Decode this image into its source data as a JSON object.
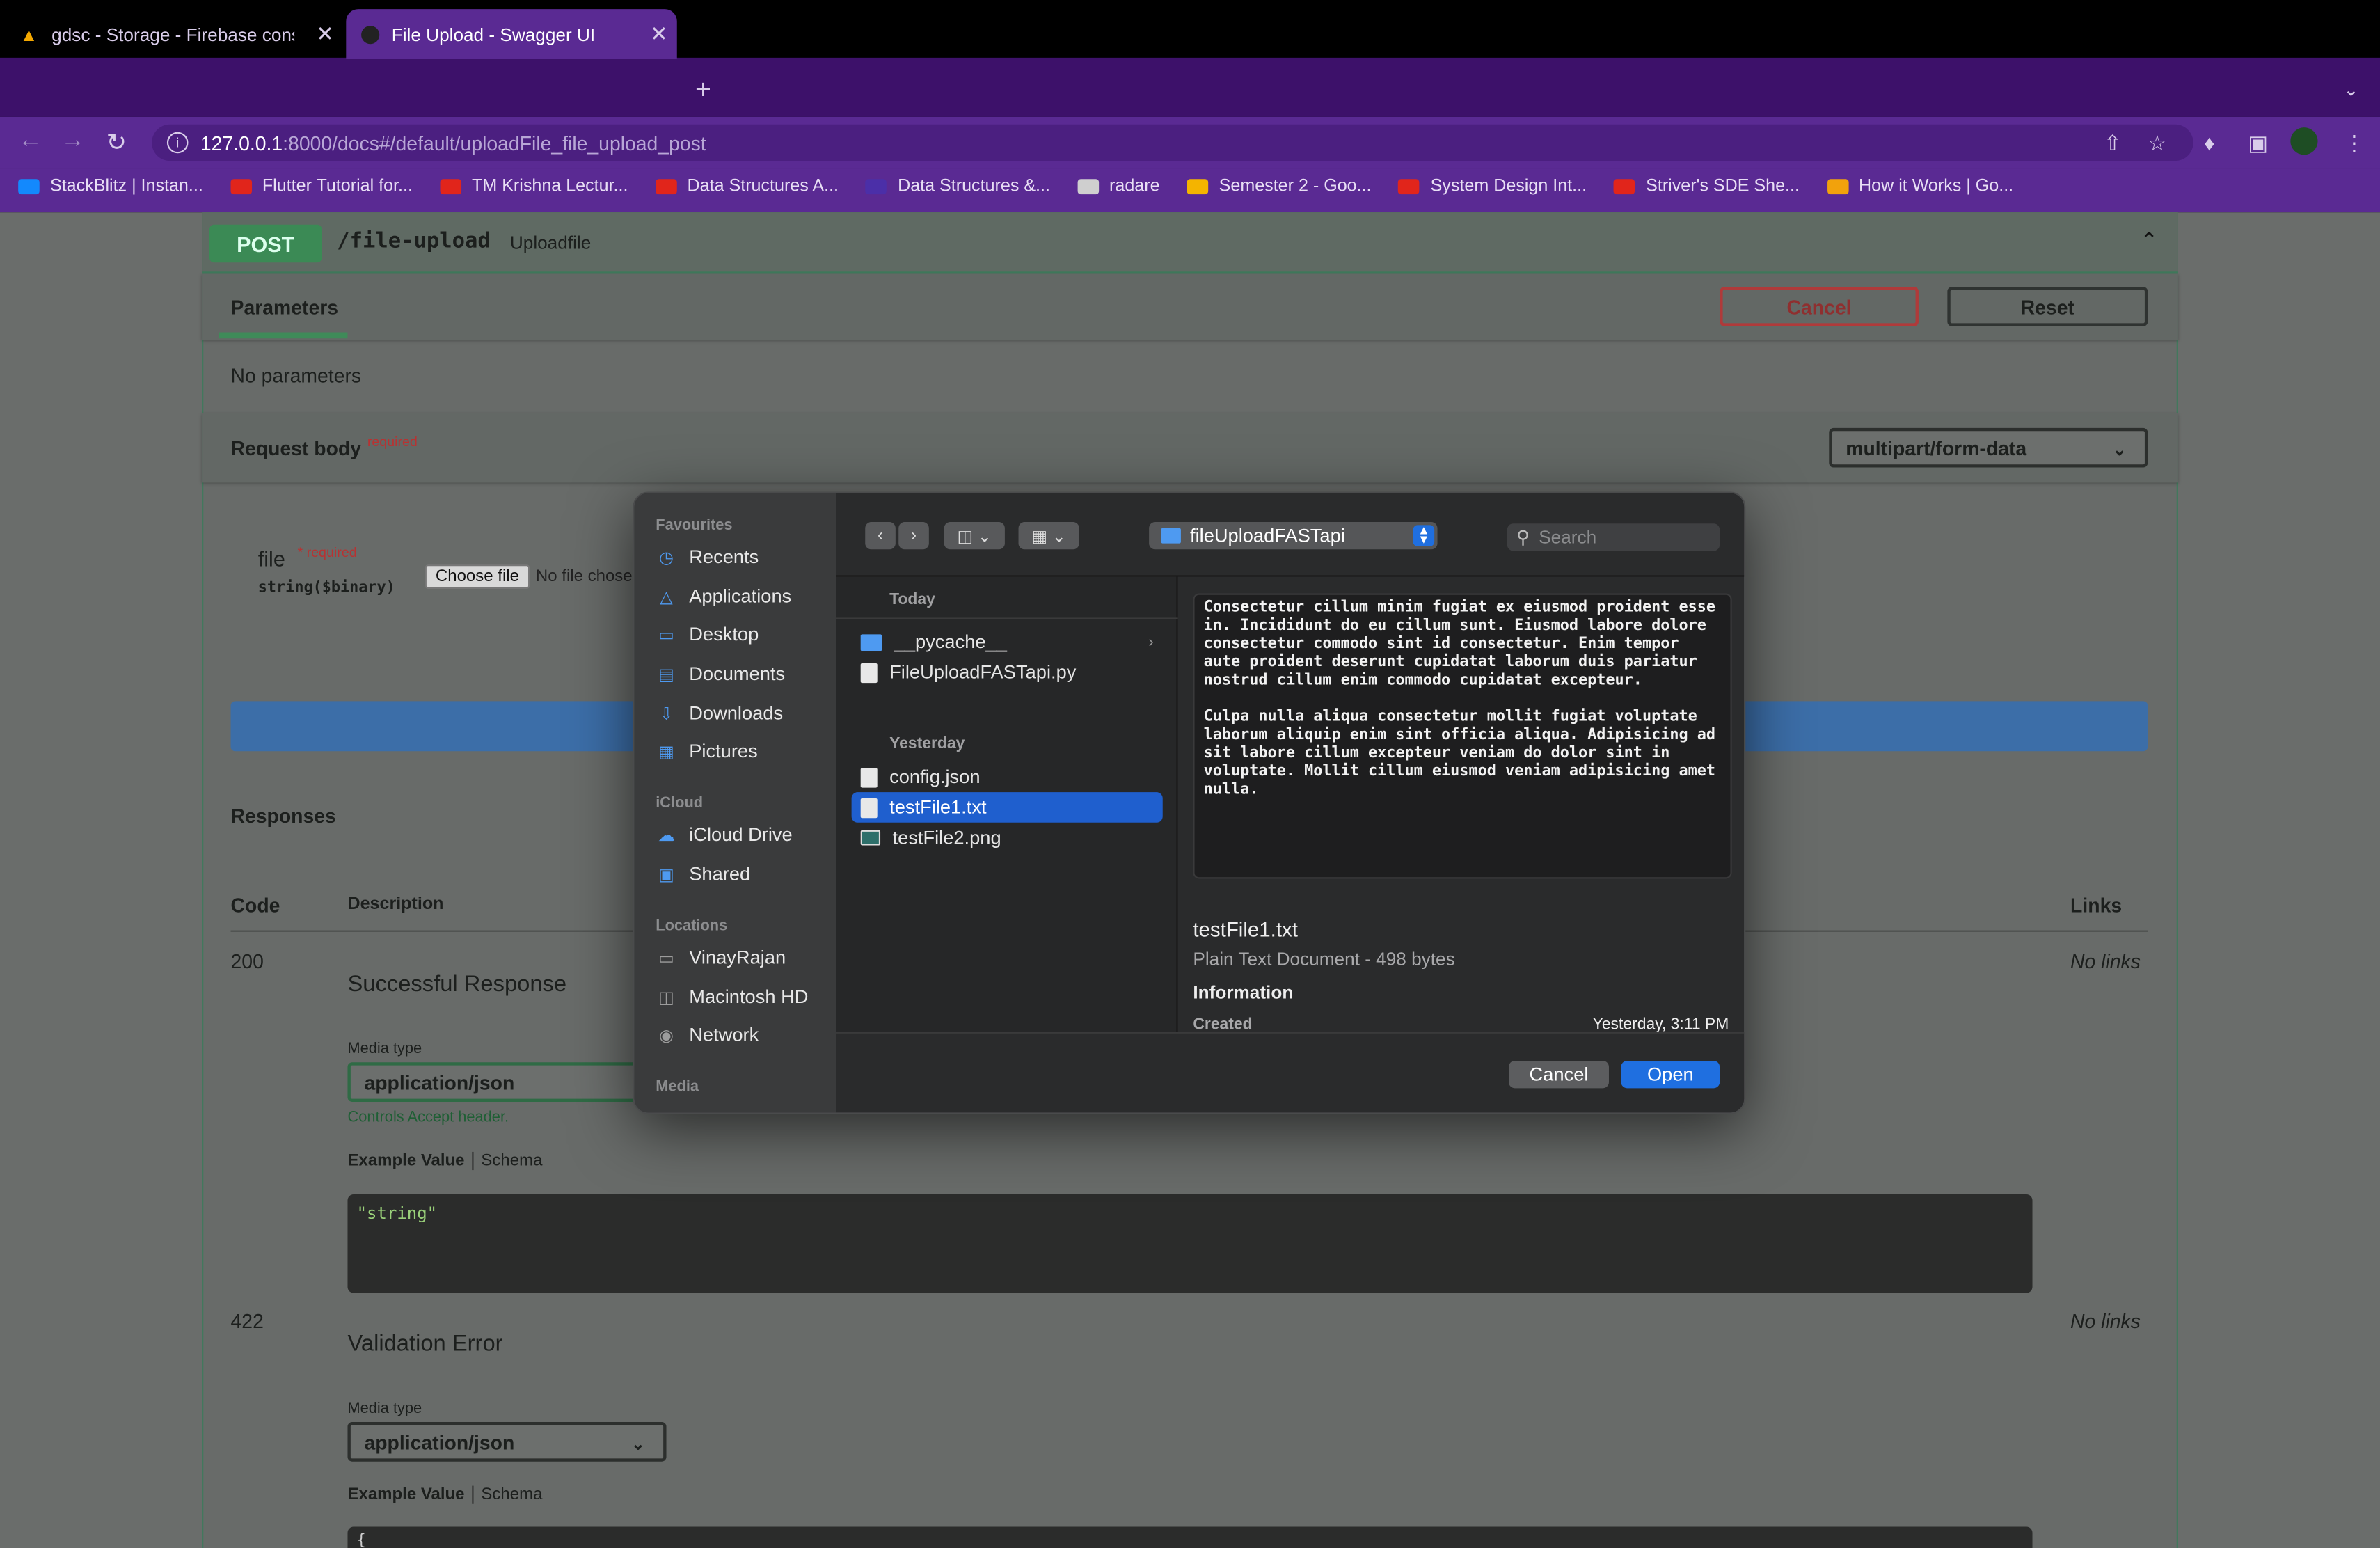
{
  "browser": {
    "tabs": [
      {
        "title": "gdsc - Storage - Firebase cons",
        "active": false
      },
      {
        "title": "File Upload - Swagger UI",
        "active": true
      }
    ],
    "url_host": "127.0.0.1",
    "url_rest": ":8000/docs#/default/uploadFile_file_upload_post",
    "bookmarks": [
      {
        "label": "StackBlitz | Instan...",
        "color": "#1389fd"
      },
      {
        "label": "Flutter Tutorial for...",
        "color": "#e1251b"
      },
      {
        "label": "TM Krishna Lectur...",
        "color": "#e1251b"
      },
      {
        "label": "Data Structures A...",
        "color": "#e1251b"
      },
      {
        "label": "Data Structures &...",
        "color": "#4b2fa8"
      },
      {
        "label": "radare",
        "color": "#cfcfcf"
      },
      {
        "label": "Semester 2 - Goo...",
        "color": "#f4b400"
      },
      {
        "label": "System Design Int...",
        "color": "#e1251b"
      },
      {
        "label": "Striver's SDE She...",
        "color": "#e1251b"
      },
      {
        "label": "How it Works | Go...",
        "color": "#f2a20c"
      }
    ]
  },
  "swagger": {
    "method": "POST",
    "path": "/file-upload",
    "summary": "Uploadfile",
    "parameters_tab": "Parameters",
    "cancel_label": "Cancel",
    "reset_label": "Reset",
    "no_parameters": "No parameters",
    "request_body_label": "Request body",
    "required_label": "required",
    "content_type": "multipart/form-data",
    "file_field": "file",
    "file_required": "* required",
    "file_type": "string($binary)",
    "choose_file": "Choose file",
    "no_file": "No file chose",
    "responses_title": "Responses",
    "col_code": "Code",
    "col_description": "Description",
    "col_links": "Links",
    "responses": [
      {
        "code": "200",
        "description": "Successful Response",
        "media_type_label": "Media type",
        "media_type": "application/json",
        "controls": "Controls Accept header.",
        "example_value": "Example Value",
        "schema": "Schema",
        "example": "\"string\"",
        "links": "No links"
      },
      {
        "code": "422",
        "description": "Validation Error",
        "media_type_label": "Media type",
        "media_type": "application/json",
        "example_value": "Example Value",
        "schema": "Schema",
        "example": "{",
        "links": "No links"
      }
    ]
  },
  "dialog": {
    "sidebar": {
      "favourites_title": "Favourites",
      "favourites": [
        {
          "label": "Recents",
          "icon": "clock-icon"
        },
        {
          "label": "Applications",
          "icon": "applications-icon"
        },
        {
          "label": "Desktop",
          "icon": "desktop-icon"
        },
        {
          "label": "Documents",
          "icon": "document-icon"
        },
        {
          "label": "Downloads",
          "icon": "download-icon"
        },
        {
          "label": "Pictures",
          "icon": "pictures-icon"
        }
      ],
      "icloud_title": "iCloud",
      "icloud": [
        {
          "label": "iCloud Drive",
          "icon": "cloud-icon"
        },
        {
          "label": "Shared",
          "icon": "shared-folder-icon"
        }
      ],
      "locations_title": "Locations",
      "locations": [
        {
          "label": "VinayRajan",
          "icon": "laptop-icon"
        },
        {
          "label": "Macintosh HD",
          "icon": "disk-icon"
        },
        {
          "label": "Network",
          "icon": "globe-icon"
        }
      ],
      "media_title": "Media"
    },
    "folder": "fileUploadFASTapi",
    "search_placeholder": "Search",
    "group_today": "Today",
    "group_yesterday": "Yesterday",
    "files_today": [
      {
        "name": "__pycache__",
        "type": "folder"
      },
      {
        "name": "FileUploadFASTapi.py",
        "type": "file"
      }
    ],
    "files_yesterday": [
      {
        "name": "config.json",
        "type": "file"
      },
      {
        "name": "testFile1.txt",
        "type": "file",
        "selected": true
      },
      {
        "name": "testFile2.png",
        "type": "image"
      }
    ],
    "preview_text": "Consectetur cillum minim fugiat ex eiusmod proident esse\nin. Incididunt do eu cillum sunt. Eiusmod labore dolore\nconsectetur commodo sint id consectetur. Enim tempor\naute proident deserunt cupidatat laborum duis pariatur\nnostrud cillum enim commodo cupidatat excepteur.\n\nCulpa nulla aliqua consectetur mollit fugiat voluptate\nlaborum aliquip enim sint officia aliqua. Adipisicing ad\nsit labore cillum excepteur veniam do dolor sint in\nvoluptate. Mollit cillum eiusmod veniam adipisicing amet\nnulla.",
    "selected_name": "testFile1.txt",
    "selected_meta": "Plain Text Document - 498 bytes",
    "info_title": "Information",
    "created_label": "Created",
    "created_value": "Yesterday, 3:11 PM",
    "cancel_label": "Cancel",
    "open_label": "Open"
  }
}
